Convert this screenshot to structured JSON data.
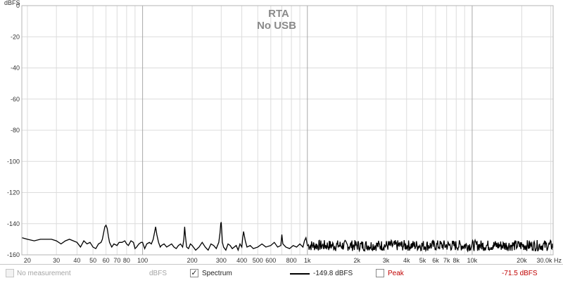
{
  "window": {
    "overlay_title": "RTA",
    "overlay_subtitle": "No USB"
  },
  "chart_data": {
    "type": "line",
    "title": "RTA",
    "subtitle": "No USB",
    "y_axis_unit": "dBFS",
    "x_axis_unit": "Hz",
    "xscale": "log",
    "xlim": [
      18.5,
      31000
    ],
    "ylim": [
      -160,
      0
    ],
    "grid": true,
    "y_ticks": [
      0,
      -20,
      -40,
      -60,
      -80,
      -100,
      -120,
      -140,
      -160
    ],
    "y_tick_labels": [
      "0",
      "-20",
      "-40",
      "-60",
      "-80",
      "-100",
      "-120",
      "-140",
      "-160"
    ],
    "x_ticks": [
      20,
      30,
      40,
      50,
      60,
      70,
      80,
      100,
      200,
      300,
      400,
      500,
      600,
      800,
      1000,
      2000,
      3000,
      4000,
      5000,
      6000,
      7000,
      8000,
      10000,
      20000,
      30000
    ],
    "x_tick_labels": [
      "20",
      "30",
      "40",
      "50",
      "60",
      "70",
      "80",
      "100",
      "200",
      "300",
      "400",
      "500",
      "600",
      "800",
      "1k",
      "2k",
      "3k",
      "4k",
      "5k",
      "6k",
      "7k",
      "8k",
      "10k",
      "20k",
      "30.0k Hz"
    ],
    "series": [
      {
        "name": "Spectrum",
        "color": "#000000",
        "x": [
          18.5,
          20,
          22,
          24,
          26,
          28,
          30,
          32,
          34,
          36,
          38,
          40,
          42,
          44,
          46,
          48,
          50,
          52,
          54,
          56,
          57,
          58,
          59,
          60,
          61,
          62,
          63,
          65,
          67,
          70,
          72,
          75,
          78,
          80,
          82,
          85,
          88,
          90,
          92,
          95,
          98,
          100,
          103,
          106,
          110,
          113,
          116,
          118,
          120,
          122,
          125,
          128,
          130,
          135,
          140,
          145,
          150,
          155,
          160,
          165,
          170,
          175,
          178,
          180,
          182,
          185,
          190,
          195,
          200,
          210,
          220,
          230,
          240,
          250,
          260,
          270,
          280,
          290,
          295,
          298,
          300,
          302,
          305,
          310,
          320,
          330,
          340,
          350,
          360,
          370,
          380,
          390,
          400,
          405,
          410,
          420,
          430,
          450,
          470,
          500,
          530,
          560,
          600,
          630,
          660,
          690,
          700,
          710,
          740,
          780,
          820,
          860,
          900,
          940,
          960,
          980,
          1000
        ],
        "values": [
          -149,
          -150,
          -151,
          -150,
          -150,
          -150,
          -151,
          -153,
          -151,
          -150,
          -151,
          -152,
          -155,
          -151,
          -153,
          -152,
          -155,
          -156,
          -153,
          -152,
          -150,
          -146,
          -142,
          -141,
          -143,
          -148,
          -152,
          -155,
          -153,
          -154,
          -152,
          -152,
          -151,
          -153,
          -154,
          -151,
          -152,
          -156,
          -155,
          -153,
          -152,
          -152,
          -156,
          -153,
          -152,
          -153,
          -150,
          -146,
          -142,
          -147,
          -152,
          -155,
          -154,
          -153,
          -155,
          -154,
          -153,
          -155,
          -156,
          -154,
          -153,
          -155,
          -150,
          -142,
          -148,
          -155,
          -156,
          -153,
          -154,
          -157,
          -155,
          -152,
          -155,
          -157,
          -153,
          -154,
          -156,
          -152,
          -146,
          -140,
          -139,
          -144,
          -152,
          -155,
          -157,
          -153,
          -154,
          -156,
          -155,
          -154,
          -157,
          -153,
          -155,
          -149,
          -145,
          -151,
          -155,
          -154,
          -156,
          -155,
          -153,
          -155,
          -154,
          -152,
          -155,
          -154,
          -147,
          -153,
          -155,
          -156,
          -154,
          -155,
          -153,
          -155,
          -151,
          -149,
          -154
        ]
      }
    ],
    "noise_floor_region": {
      "from_hz": 1000,
      "to_hz": 31000,
      "mean_dbfs": -154,
      "spread_db": 7
    }
  },
  "legend": {
    "no_measurement": {
      "label": "No measurement",
      "unit": "dBFS",
      "checked": false,
      "enabled": false
    },
    "spectrum": {
      "label": "Spectrum",
      "checked": true,
      "color": "#000000",
      "readout": "-149.8 dBFS"
    },
    "peak": {
      "label": "Peak",
      "checked": false,
      "color": "#c00000",
      "readout": "-71.5 dBFS"
    }
  }
}
